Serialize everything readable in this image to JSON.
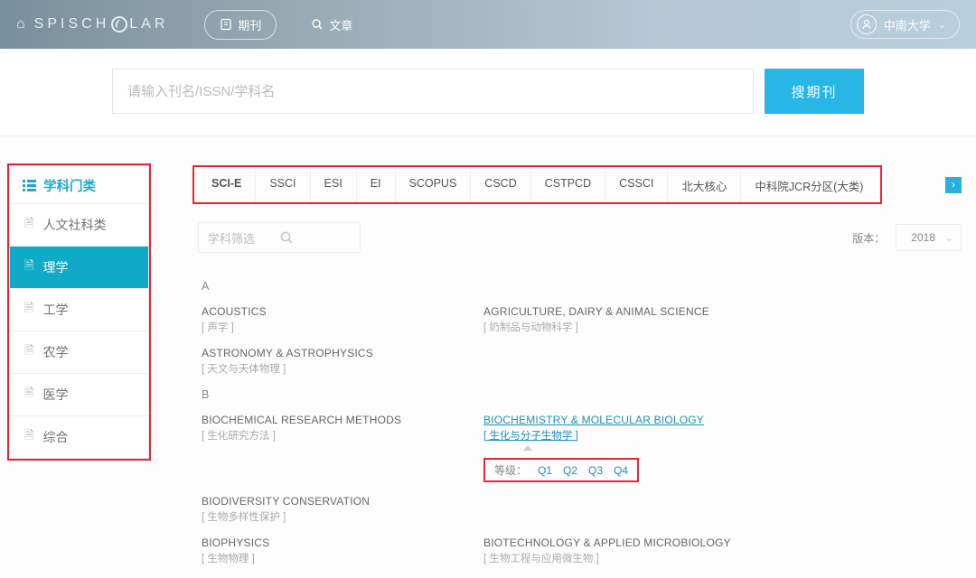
{
  "header": {
    "logo_text": "SPISCHOLAR",
    "nav": [
      {
        "label": "期刊",
        "active": true
      },
      {
        "label": "文章",
        "active": false
      }
    ],
    "user": "中南大学"
  },
  "search": {
    "placeholder": "请输入刊名/ISSN/学科名",
    "button": "搜期刊"
  },
  "sidebar": {
    "title": "学科门类",
    "items": [
      {
        "label": "人文社科类",
        "active": false
      },
      {
        "label": "理学",
        "active": true
      },
      {
        "label": "工学",
        "active": false
      },
      {
        "label": "农学",
        "active": false
      },
      {
        "label": "医学",
        "active": false
      },
      {
        "label": "综合",
        "active": false
      }
    ]
  },
  "tabs": [
    "SCI-E",
    "SSCI",
    "ESI",
    "EI",
    "SCOPUS",
    "CSCD",
    "CSTPCD",
    "CSSCI",
    "北大核心",
    "中科院JCR分区(大类)"
  ],
  "filter_placeholder": "学科筛选",
  "version": {
    "label": "版本：",
    "value": "2018"
  },
  "groups": [
    {
      "letter": "A",
      "rows": [
        [
          {
            "title": "ACOUSTICS",
            "sub": "[ 声学 ]"
          },
          {
            "title": "AGRICULTURE, DAIRY & ANIMAL SCIENCE",
            "sub": "[ 奶制品与动物科学 ]"
          }
        ],
        [
          {
            "title": "ASTRONOMY & ASTROPHYSICS",
            "sub": "[ 天文与天体物理 ]"
          },
          null
        ]
      ]
    },
    {
      "letter": "B",
      "rows": [
        [
          {
            "title": "BIOCHEMICAL RESEARCH METHODS",
            "sub": "[ 生化研究方法 ]"
          },
          {
            "title": "BIOCHEMISTRY & MOLECULAR BIOLOGY",
            "sub": "[ 生化与分子生物学 ]",
            "link": true,
            "ranks": {
              "label": "等级：",
              "items": [
                "Q1",
                "Q2",
                "Q3",
                "Q4"
              ]
            }
          }
        ],
        [
          {
            "title": "BIODIVERSITY CONSERVATION",
            "sub": "[ 生物多样性保护 ]"
          },
          null
        ],
        [
          {
            "title": "BIOPHYSICS",
            "sub": "[ 生物物理 ]"
          },
          {
            "title": "BIOTECHNOLOGY & APPLIED MICROBIOLOGY",
            "sub": "[ 生物工程与应用微生物 ]"
          }
        ]
      ]
    }
  ]
}
